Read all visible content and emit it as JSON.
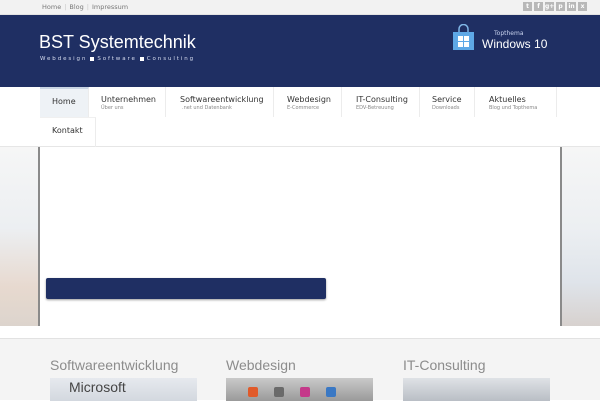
{
  "topbar": {
    "links": [
      "Home",
      "Blog",
      "Impressum"
    ],
    "social_icons": [
      "twitter-icon",
      "facebook-icon",
      "google-plus-icon",
      "pinterest-icon",
      "linkedin-icon",
      "xing-icon"
    ],
    "social_glyphs": [
      "t",
      "f",
      "g+",
      "p",
      "in",
      "x"
    ]
  },
  "header": {
    "title": "BST Systemtechnik",
    "tagline": [
      "Webdesign",
      "Software",
      "Consulting"
    ],
    "promo_small": "Topthema",
    "promo_big": "Windows 10",
    "bg_color": "#1f2f63"
  },
  "nav": {
    "items": [
      {
        "label": "Home",
        "sub": ""
      },
      {
        "label": "Unternehmen",
        "sub": "Über uns"
      },
      {
        "label": "Softwareentwicklung",
        "sub": ".net und Datenbank"
      },
      {
        "label": "Webdesign",
        "sub": "E-Commerce"
      },
      {
        "label": "IT-Consulting",
        "sub": "EDV-Betreuung"
      },
      {
        "label": "Service",
        "sub": "Downloads"
      },
      {
        "label": "Aktuelles",
        "sub": "Blog und Topthema"
      },
      {
        "label": "Kontakt",
        "sub": ""
      }
    ]
  },
  "features": [
    {
      "title": "Softwareentwicklung",
      "thumb_text": "Microsoft"
    },
    {
      "title": "Webdesign"
    },
    {
      "title": "IT-Consulting"
    }
  ]
}
